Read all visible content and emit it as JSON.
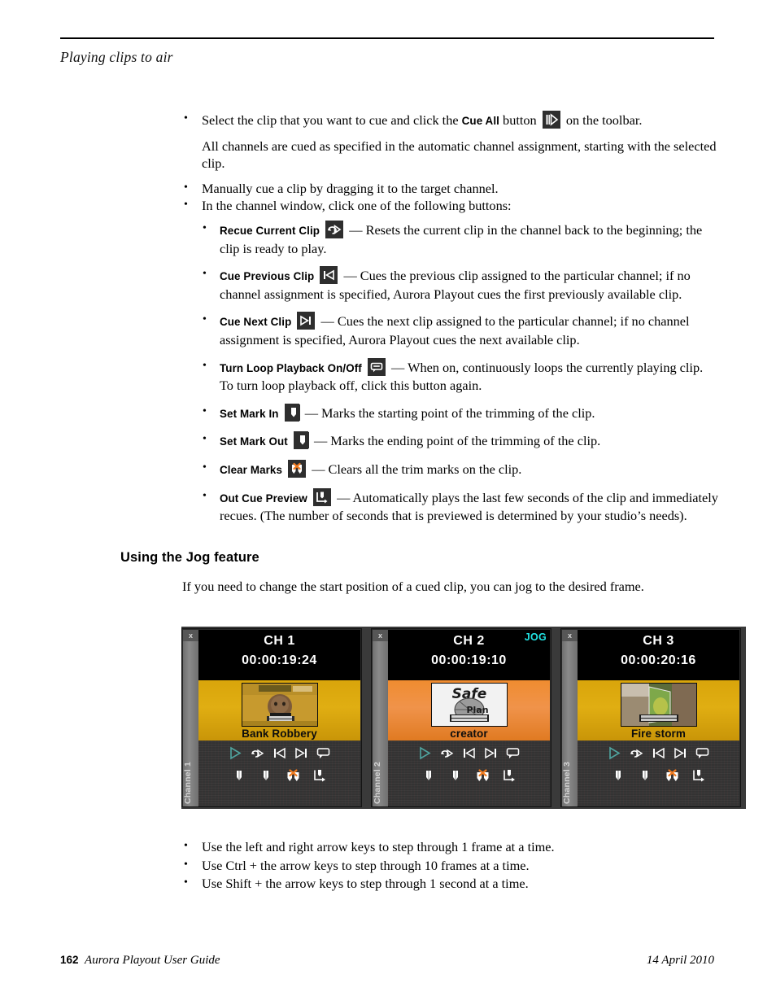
{
  "page": {
    "running_head": "Playing clips to air",
    "section_heading": "Using the Jog feature",
    "section_intro": "If you need to change the start position of a cued clip, you can jog to the desired frame."
  },
  "bullets_top": {
    "b1_pre": "Select the clip that you want to cue and click the ",
    "b1_term": "Cue All",
    "b1_mid": " button ",
    "b1_post": " on the toolbar.",
    "b1_icon": "cue-all-icon",
    "para1": "All channels are cued as specified in the automatic channel assignment, starting with the selected clip.",
    "b2": "Manually cue a clip by dragging it to the target channel.",
    "b3": "In the channel window, click one of the following buttons:"
  },
  "button_defs": [
    {
      "term": "Recue Current Clip",
      "icon": "recue-current-clip-icon",
      "desc": "— Resets the current clip in the channel back to the beginning; the clip is ready to play."
    },
    {
      "term": "Cue Previous Clip",
      "icon": "cue-previous-clip-icon",
      "desc": "— Cues the previous clip assigned to the particular channel; if no channel assignment is specified, Aurora Playout cues the first previously available clip."
    },
    {
      "term": "Cue Next Clip",
      "icon": "cue-next-clip-icon",
      "desc": "— Cues the next clip assigned to the particular channel; if no channel assignment is specified, Aurora Playout cues the next available clip."
    },
    {
      "term": "Turn Loop Playback On/Off",
      "icon": "loop-playback-icon",
      "desc": "— When on, continuously loops the currently playing clip. To turn loop playback off, click this button again."
    },
    {
      "term": "Set Mark In",
      "icon": "set-mark-in-icon",
      "desc": "— Marks the starting point of the trimming of the clip."
    },
    {
      "term": "Set Mark Out",
      "icon": "set-mark-out-icon",
      "desc": "— Marks the ending point of the trimming of the clip."
    },
    {
      "term": "Clear Marks",
      "icon": "clear-marks-icon",
      "desc": "— Clears all the trim marks on the clip."
    },
    {
      "term": "Out Cue Preview",
      "icon": "out-cue-preview-icon",
      "desc": "— Automatically plays the last few seconds of the clip and immediately recues. (The number of seconds that is previewed is determined by your studio’s needs)."
    }
  ],
  "screenshot": {
    "channels": [
      {
        "tab_label": "Channel 1",
        "close_label": "x",
        "name": "CH 1",
        "timecode": "00:00:19:24",
        "clip_name": "Bank Robbery",
        "jog": "",
        "strip_color": "#d9a50b",
        "controls_row1": [
          "play-icon",
          "recue-icon",
          "cue-previous-icon",
          "cue-next-icon",
          "loop-icon"
        ],
        "controls_row2": [
          "mark-in-icon",
          "mark-out-icon",
          "clear-marks-icon",
          "out-cue-preview-icon"
        ]
      },
      {
        "tab_label": "Channel 2",
        "close_label": "x",
        "name": "CH 2",
        "timecode": "00:00:19:10",
        "clip_name": "creator",
        "jog": "JOG",
        "strip_color": "#ef8c30",
        "controls_row1": [
          "play-icon",
          "recue-icon",
          "cue-previous-icon",
          "cue-next-icon",
          "loop-icon"
        ],
        "controls_row2": [
          "mark-in-icon",
          "mark-out-icon",
          "clear-marks-icon",
          "out-cue-preview-icon"
        ]
      },
      {
        "tab_label": "Channel 3",
        "close_label": "x",
        "name": "CH 3",
        "timecode": "00:00:20:16",
        "clip_name": "Fire storm",
        "jog": "",
        "strip_color": "#d9a50b",
        "controls_row1": [
          "play-icon",
          "recue-icon",
          "cue-previous-icon",
          "cue-next-icon",
          "loop-icon"
        ],
        "controls_row2": [
          "mark-in-icon",
          "mark-out-icon",
          "clear-marks-icon",
          "out-cue-preview-icon"
        ]
      }
    ],
    "accent_jog_color": "#21e3e3",
    "accent_play_color": "#4fa5a0",
    "accent_clear_color": "#f07a1e"
  },
  "bullets_bottom": [
    "Use the left and right arrow keys to step through 1 frame at a time.",
    "Use Ctrl + the arrow keys to step through 10 frames at a time.",
    "Use Shift + the arrow keys to step through 1 second at a time."
  ],
  "footer": {
    "page_number": "162",
    "guide_title": "Aurora Playout User Guide",
    "date": "14  April  2010"
  }
}
